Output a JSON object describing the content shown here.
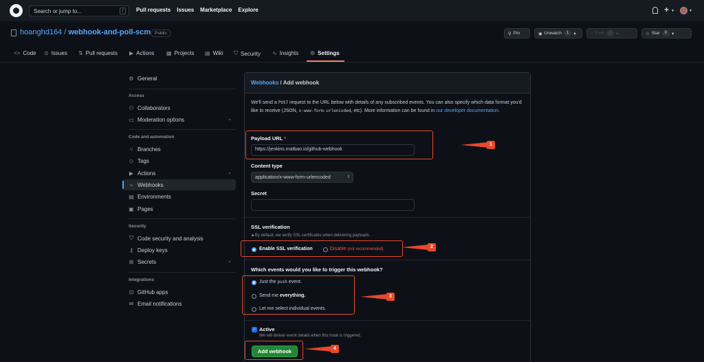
{
  "header": {
    "search_placeholder": "Search or jump to...",
    "search_key": "/",
    "nav": [
      "Pull requests",
      "Issues",
      "Marketplace",
      "Explore"
    ]
  },
  "repo": {
    "owner": "hoanghd164",
    "separator": "/",
    "name": "webhook-and-poll-scm",
    "visibility": "Public",
    "pin_label": "Pin",
    "unwatch_label": "Unwatch",
    "unwatch_count": "1",
    "fork_label": "Fork",
    "fork_count": "0",
    "star_label": "Star",
    "star_count": "0"
  },
  "tabs": [
    {
      "label": "Code",
      "icon": "code-icon"
    },
    {
      "label": "Issues",
      "icon": "issue-icon"
    },
    {
      "label": "Pull requests",
      "icon": "pull-request-icon"
    },
    {
      "label": "Actions",
      "icon": "play-icon"
    },
    {
      "label": "Projects",
      "icon": "table-icon"
    },
    {
      "label": "Wiki",
      "icon": "book-icon"
    },
    {
      "label": "Security",
      "icon": "shield-icon"
    },
    {
      "label": "Insights",
      "icon": "graph-icon"
    },
    {
      "label": "Settings",
      "icon": "gear-icon",
      "active": true
    }
  ],
  "sidebar": {
    "general": "General",
    "access_heading": "Access",
    "access": [
      "Collaborators",
      "Moderation options"
    ],
    "code_heading": "Code and automation",
    "code": [
      "Branches",
      "Tags",
      "Actions",
      "Webhooks",
      "Environments",
      "Pages"
    ],
    "security_heading": "Security",
    "security": [
      "Code security and analysis",
      "Deploy keys",
      "Secrets"
    ],
    "integrations_heading": "Integrations",
    "integrations": [
      "GitHub apps",
      "Email notifications"
    ],
    "active_item": "Webhooks"
  },
  "form": {
    "breadcrumb_link": "Webhooks",
    "breadcrumb_rest": "/ Add webhook",
    "intro_1": "We'll send a",
    "intro_code_1": "POST",
    "intro_2": "request to the URL below with details of any subscribed events. You can also specify which data format you'd like to receive (JSON,",
    "intro_code_2": "x-www-form-urlencoded",
    "intro_3": ", etc). More information can be found in",
    "intro_4": "our developer documentation",
    "intro_5": ".",
    "payload_label": "Payload URL",
    "payload_required": "*",
    "payload_value": "https://jenkins.matbao.io/github-webhook",
    "content_type_label": "Content type",
    "content_type_value": "application/x-www-form-urlencoded",
    "secret_label": "Secret",
    "secret_value": "",
    "ssl_label": "SSL verification",
    "ssl_hint": "By default, we verify SSL certificates when delivering payloads.",
    "ssl_enable": "Enable SSL verification",
    "ssl_disable": "Disable",
    "ssl_disable_note": "(not recommended)",
    "events_label": "Which events would you like to trigger this webhook?",
    "event_push_1": "Just the",
    "event_push_code": "push",
    "event_push_2": "event.",
    "event_all_1": "Send me",
    "event_all_2": "everything.",
    "event_select": "Let me select individual events.",
    "active_label": "Active",
    "active_hint": "We will deliver event details when this hook is triggered.",
    "submit_label": "Add webhook"
  },
  "annotations": [
    "1",
    "2",
    "3",
    "4"
  ],
  "colors": {
    "annotation": "#e8482b",
    "accent": "#58a6ff",
    "primary_button": "#238636",
    "background": "#0d1117"
  }
}
